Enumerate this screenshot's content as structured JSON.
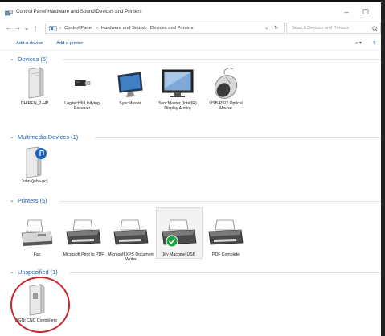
{
  "window": {
    "title": "Control Panel\\Hardware and Sound\\Devices and Printers",
    "minimize": "–",
    "maximize": "☐",
    "close": "✕",
    "icon": "devices-printers-icon"
  },
  "nav": {
    "back": "←",
    "forward": "→",
    "recent": "⌄",
    "up": "↑"
  },
  "address": {
    "crumbs": [
      "›",
      "Control Panel",
      "›",
      "Hardware and Sound",
      "›",
      "Devices and Printers"
    ],
    "dropdown": "⌄",
    "refresh": "↻"
  },
  "search": {
    "placeholder": "Search Devices and Printers",
    "icon": "search-icon"
  },
  "commands": {
    "add_device": "Add a device",
    "add_printer": "Add a printer",
    "view": "≡ ▾",
    "help": "?"
  },
  "groups": {
    "devices": {
      "title": "Devices (5)",
      "items": [
        {
          "label": "DHIREN_2-HP",
          "icon": "computer-tower-icon"
        },
        {
          "label": "Logitech® Unifying Receiver",
          "icon": "usb-receiver-icon"
        },
        {
          "label": "SyncMaster",
          "icon": "monitor-icon"
        },
        {
          "label": "SyncMaster (Intel(R) Display Audio)",
          "icon": "monitor-icon"
        },
        {
          "label": "USB-PS/2 Optical Mouse",
          "icon": "mouse-icon"
        }
      ]
    },
    "multimedia": {
      "title": "Multimedia Devices (1)",
      "items": [
        {
          "label": "John (john-pc)",
          "icon": "media-device-icon"
        }
      ]
    },
    "printers": {
      "title": "Printers (5)",
      "items": [
        {
          "label": "Fax",
          "icon": "fax-icon"
        },
        {
          "label": "Microsoft Print to PDF",
          "icon": "printer-icon"
        },
        {
          "label": "Microsoft XPS Document Writer",
          "icon": "printer-icon"
        },
        {
          "label": "My Machine-USB",
          "icon": "printer-default-icon"
        },
        {
          "label": "PDF Complete",
          "icon": "printer-icon"
        }
      ]
    },
    "unspecified": {
      "title": "Unspecified (1)",
      "items": [
        {
          "label": "AGNI CNC Controllers",
          "icon": "cnc-controller-icon"
        }
      ]
    }
  },
  "colors": {
    "link": "#1a4e8a",
    "group_title": "#1f5fa8",
    "highlight_circle": "#c8262f",
    "default_check": "#1aa340"
  }
}
